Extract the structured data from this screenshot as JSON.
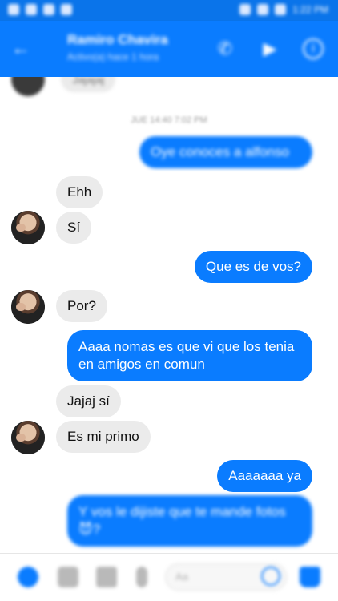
{
  "header": {
    "title": "Ramiro Chavira",
    "subtitle": "Activo(a) hace 1 hora",
    "back_icon": "←",
    "call_icon": "✆",
    "video_icon": "▶",
    "info_icon": "i"
  },
  "status_bar": {
    "time": "1:22 PM"
  },
  "chat": {
    "partial_bubble": "Jajajaj",
    "timestamp": "JUE 14:40 7:02 PM",
    "messages": [
      {
        "side": "out",
        "text": "Oye conoces a alfonso"
      },
      {
        "side": "in",
        "text": "Ehh"
      },
      {
        "side": "in",
        "text": "Sí"
      },
      {
        "side": "out",
        "text": "Que es de vos?"
      },
      {
        "side": "in",
        "text": "Por?"
      },
      {
        "side": "out",
        "text": "Aaaa nomas es que vi que los tenia en amigos en comun"
      },
      {
        "side": "in",
        "text": "Jajaj sí"
      },
      {
        "side": "in",
        "text": "Es mi primo"
      },
      {
        "side": "out",
        "text": "Aaaaaaa ya"
      },
      {
        "side": "out",
        "text": "Y vos le dijiste que te mande fotos😈?"
      }
    ]
  },
  "composer": {
    "placeholder": "Aa"
  },
  "colors": {
    "accent": "#0a7cff",
    "incoming_bubble": "#ebebeb"
  }
}
